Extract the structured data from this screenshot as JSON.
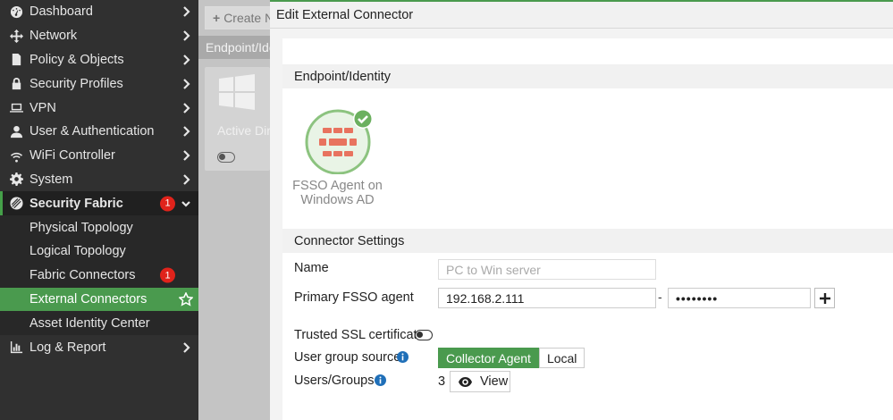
{
  "sidebar": {
    "items": [
      {
        "label": "Dashboard",
        "icon": "dashboard-icon"
      },
      {
        "label": "Network",
        "icon": "network-icon"
      },
      {
        "label": "Policy & Objects",
        "icon": "policy-icon"
      },
      {
        "label": "Security Profiles",
        "icon": "lock-icon"
      },
      {
        "label": "VPN",
        "icon": "laptop-icon"
      },
      {
        "label": "User & Authentication",
        "icon": "user-icon"
      },
      {
        "label": "WiFi Controller",
        "icon": "wifi-icon"
      },
      {
        "label": "System",
        "icon": "gear-icon"
      },
      {
        "label": "Security Fabric",
        "icon": "fabric-icon",
        "badge": "1"
      }
    ],
    "subitems": [
      {
        "label": "Physical Topology"
      },
      {
        "label": "Logical Topology"
      },
      {
        "label": "Fabric Connectors",
        "badge": "1"
      },
      {
        "label": "External Connectors"
      },
      {
        "label": "Asset Identity Center"
      }
    ],
    "last_item": {
      "label": "Log & Report",
      "icon": "chart-icon"
    }
  },
  "background": {
    "create_button": "Create N",
    "section_label": "Endpoint/Ide",
    "card_label": "Active Dir"
  },
  "dialog": {
    "title": "Edit External Connector",
    "endpoint_section": "Endpoint/Identity",
    "connector_name": "FSSO Agent on Windows AD",
    "settings_section": "Connector Settings",
    "name_label": "Name",
    "name_placeholder": "PC to Win server",
    "primary_label": "Primary FSSO agent",
    "primary_ip": "192.168.2.111",
    "primary_password": "••••••••",
    "dash": "-",
    "trusted_ssl_label": "Trusted SSL certificate",
    "user_group_source_label": "User group source",
    "source_options": [
      "Collector Agent",
      "Local"
    ],
    "users_groups_label": "Users/Groups",
    "users_groups_count": "3",
    "view_button": "View"
  },
  "colors": {
    "accent_green": "#4a9a4e",
    "badge_red": "#e0231b",
    "sidebar_bg": "#303030",
    "fortinet_red": "#e8735f"
  }
}
